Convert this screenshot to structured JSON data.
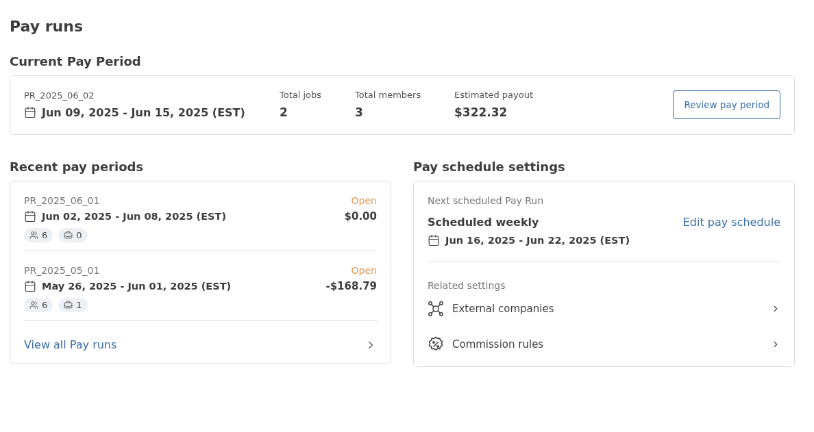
{
  "page_title": "Pay runs",
  "current": {
    "heading": "Current Pay Period",
    "id": "PR_2025_06_02",
    "dates": "Jun 09, 2025 - Jun 15, 2025 (EST)",
    "stats": [
      {
        "label": "Total jobs",
        "value": "2"
      },
      {
        "label": "Total members",
        "value": "3"
      },
      {
        "label": "Estimated payout",
        "value": "$322.32"
      }
    ],
    "button": "Review pay period"
  },
  "recent": {
    "heading": "Recent pay periods",
    "periods": [
      {
        "id": "PR_2025_06_01",
        "status": "Open",
        "dates": "Jun 02, 2025 - Jun 08, 2025 (EST)",
        "amount": "$0.00",
        "members": "6",
        "jobs": "0"
      },
      {
        "id": "PR_2025_05_01",
        "status": "Open",
        "dates": "May 26, 2025 - Jun 01, 2025 (EST)",
        "amount": "-$168.79",
        "members": "6",
        "jobs": "1"
      }
    ],
    "view_all": "View all Pay runs"
  },
  "schedule": {
    "heading": "Pay schedule settings",
    "next_label": "Next scheduled Pay Run",
    "frequency": "Scheduled weekly",
    "edit_link": "Edit pay schedule",
    "dates": "Jun 16, 2025 - Jun 22, 2025 (EST)",
    "related_label": "Related settings",
    "related": [
      {
        "kind": "network",
        "label": "External companies"
      },
      {
        "kind": "percent",
        "label": "Commission rules"
      }
    ]
  }
}
